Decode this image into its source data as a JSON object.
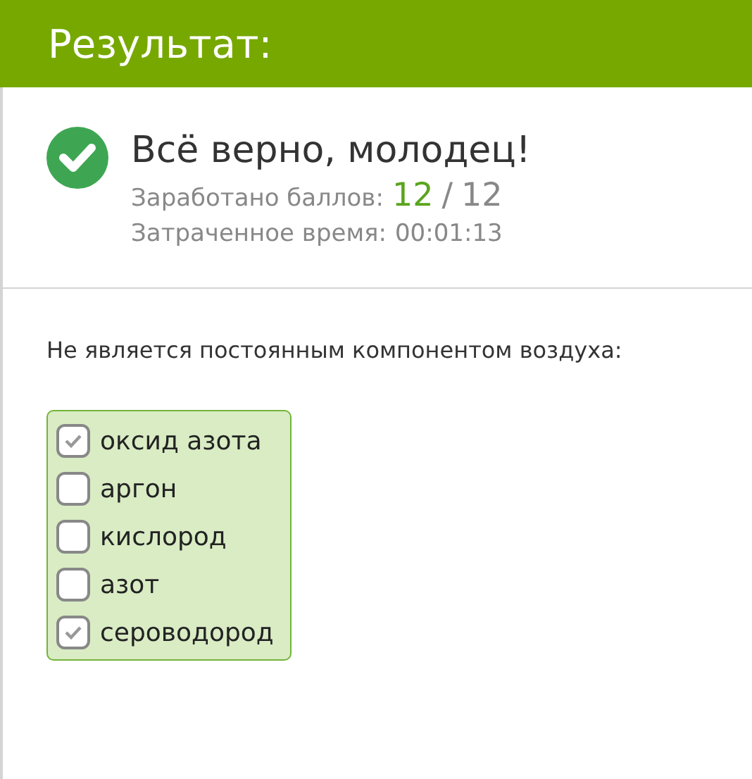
{
  "header": {
    "title": "Результат:"
  },
  "result": {
    "message": "Всё верно, молодец!",
    "score_label": "Заработано баллов:",
    "score_earned": "12",
    "score_separator": "/",
    "score_total": "12",
    "time_label": "Затраченное время:",
    "time": "00:01:13"
  },
  "question": {
    "text": "Не является постоянным компонентом воздуха:",
    "correct": true,
    "options": [
      {
        "label": "оксид азота",
        "checked": true
      },
      {
        "label": "аргон",
        "checked": false
      },
      {
        "label": "кислород",
        "checked": false
      },
      {
        "label": "азот",
        "checked": false
      },
      {
        "label": "сероводород",
        "checked": true
      }
    ]
  }
}
